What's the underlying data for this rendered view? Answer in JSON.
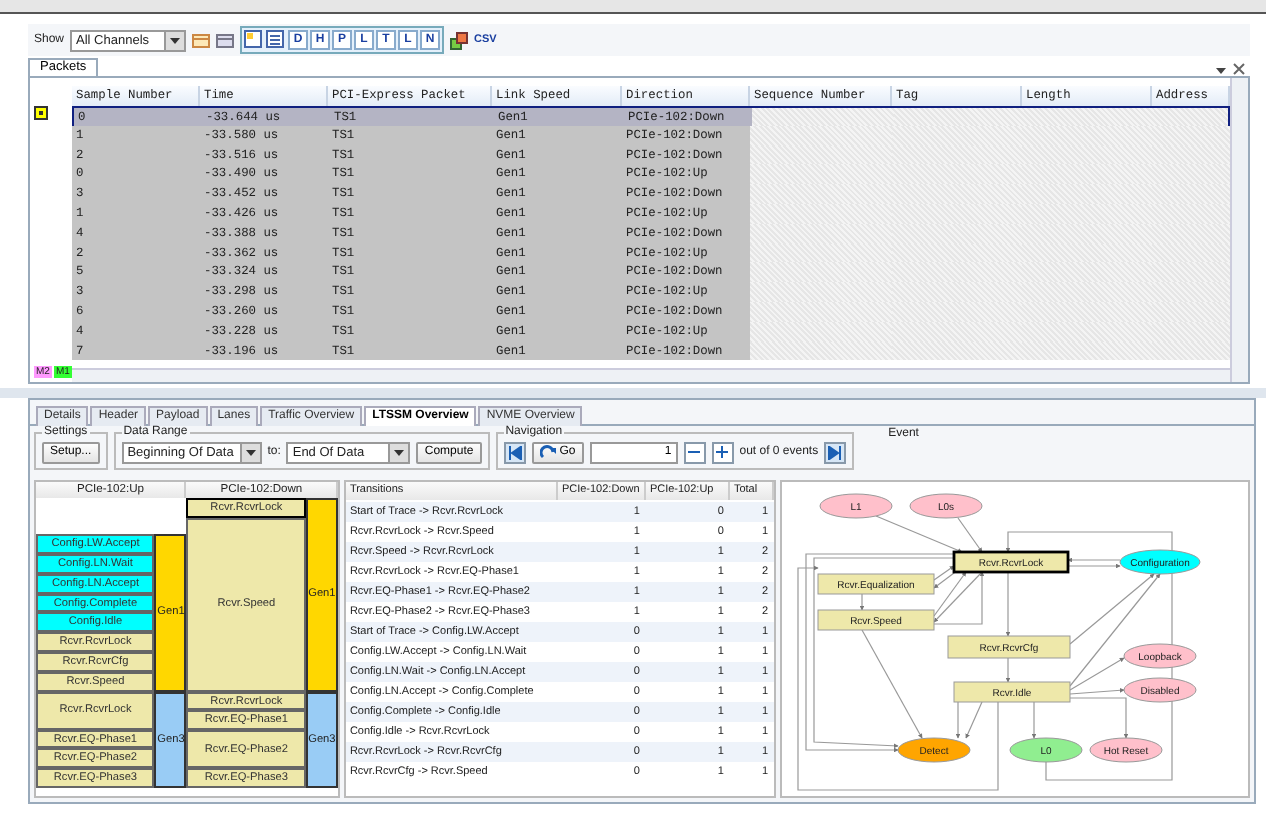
{
  "toolbar": {
    "show_label": "Show",
    "channel_select": "All Channels",
    "view_buttons": [
      {
        "label": "D"
      },
      {
        "label": "H"
      },
      {
        "label": "P"
      },
      {
        "label": "L"
      },
      {
        "label": "T"
      },
      {
        "label": "L"
      },
      {
        "label": "N"
      }
    ],
    "export_label": "CSV"
  },
  "document_tab": {
    "label": "Packets"
  },
  "packets": {
    "columns": [
      "Sample Number",
      "Time",
      "PCI-Express Packet",
      "Link Speed",
      "Direction",
      "Sequence Number",
      "Tag",
      "Length",
      "Address"
    ],
    "rows": [
      {
        "sample": "0",
        "time": "-33.644 us",
        "packet": "TS1",
        "speed": "Gen1",
        "direction": "PCIe-102:Down",
        "selected": true
      },
      {
        "sample": "1",
        "time": "-33.580 us",
        "packet": "TS1",
        "speed": "Gen1",
        "direction": "PCIe-102:Down",
        "selected": false
      },
      {
        "sample": "2",
        "time": "-33.516 us",
        "packet": "TS1",
        "speed": "Gen1",
        "direction": "PCIe-102:Down",
        "selected": false
      },
      {
        "sample": "0",
        "time": "-33.490 us",
        "packet": "TS1",
        "speed": "Gen1",
        "direction": "PCIe-102:Up",
        "selected": false
      },
      {
        "sample": "3",
        "time": "-33.452 us",
        "packet": "TS1",
        "speed": "Gen1",
        "direction": "PCIe-102:Down",
        "selected": false
      },
      {
        "sample": "1",
        "time": "-33.426 us",
        "packet": "TS1",
        "speed": "Gen1",
        "direction": "PCIe-102:Up",
        "selected": false
      },
      {
        "sample": "4",
        "time": "-33.388 us",
        "packet": "TS1",
        "speed": "Gen1",
        "direction": "PCIe-102:Down",
        "selected": false
      },
      {
        "sample": "2",
        "time": "-33.362 us",
        "packet": "TS1",
        "speed": "Gen1",
        "direction": "PCIe-102:Up",
        "selected": false
      },
      {
        "sample": "5",
        "time": "-33.324 us",
        "packet": "TS1",
        "speed": "Gen1",
        "direction": "PCIe-102:Down",
        "selected": false
      },
      {
        "sample": "3",
        "time": "-33.298 us",
        "packet": "TS1",
        "speed": "Gen1",
        "direction": "PCIe-102:Up",
        "selected": false
      },
      {
        "sample": "6",
        "time": "-33.260 us",
        "packet": "TS1",
        "speed": "Gen1",
        "direction": "PCIe-102:Down",
        "selected": false
      },
      {
        "sample": "4",
        "time": "-33.228 us",
        "packet": "TS1",
        "speed": "Gen1",
        "direction": "PCIe-102:Up",
        "selected": false
      },
      {
        "sample": "7",
        "time": "-33.196 us",
        "packet": "TS1",
        "speed": "Gen1",
        "direction": "PCIe-102:Down",
        "selected": false
      }
    ]
  },
  "markers": [
    {
      "label": "M2",
      "color": "#ff99ff"
    },
    {
      "label": "M1",
      "color": "#33ff33"
    }
  ],
  "bottom_tabs": [
    {
      "label": "Details",
      "selected": false
    },
    {
      "label": "Header",
      "selected": false
    },
    {
      "label": "Payload",
      "selected": false
    },
    {
      "label": "Lanes",
      "selected": false
    },
    {
      "label": "Traffic Overview",
      "selected": false
    },
    {
      "label": "LTSSM Overview",
      "selected": true
    },
    {
      "label": "NVME Overview",
      "selected": false
    }
  ],
  "settings": {
    "title": "Settings",
    "button": "Setup..."
  },
  "data_range": {
    "title": "Data Range",
    "from": "Beginning Of Data",
    "to_label": "to:",
    "to": "End Of Data",
    "button": "Compute"
  },
  "navigation": {
    "title": "Navigation",
    "go": "Go",
    "event_number": "1",
    "count_text": "out of 0 events"
  },
  "event": {
    "title": "Event"
  },
  "ltssm": {
    "lanes": [
      {
        "name": "PCIe-102:Up",
        "gens": [
          {
            "label": "Gen1",
            "color": "#ffd700",
            "states": [
              {
                "label": "Config.LW.Accept",
                "kind": "short",
                "color": "#00ffff",
                "selected": false
              },
              {
                "label": "Config.LN.Wait",
                "kind": "short",
                "color": "#00ffff",
                "selected": false
              },
              {
                "label": "Config.LN.Accept",
                "kind": "short",
                "color": "#00ffff",
                "selected": false
              },
              {
                "label": "Config.Complete",
                "kind": "short",
                "color": "#00ffff",
                "selected": false
              },
              {
                "label": "Config.Idle",
                "kind": "short",
                "color": "#00ffff",
                "selected": false
              },
              {
                "label": "Rcvr.RcvrLock",
                "kind": "short",
                "color": "#eee8aa",
                "selected": false
              },
              {
                "label": "Rcvr.RcvrCfg",
                "kind": "short",
                "color": "#eee8aa",
                "selected": false
              },
              {
                "label": "Rcvr.Speed",
                "kind": "short",
                "color": "#eee8aa",
                "selected": false
              }
            ]
          },
          {
            "label": "Gen3",
            "color": "#99ccf5",
            "states": [
              {
                "label": "Rcvr.RcvrLock",
                "kind": "long",
                "color": "#eee8aa",
                "selected": false
              },
              {
                "label": "Rcvr.EQ-Phase1",
                "kind": "short",
                "color": "#eee8aa",
                "selected": false
              },
              {
                "label": "Rcvr.EQ-Phase2",
                "kind": "short",
                "color": "#eee8aa",
                "selected": false
              },
              {
                "label": "Rcvr.EQ-Phase3",
                "kind": "short",
                "color": "#eee8aa",
                "selected": false
              }
            ]
          }
        ]
      },
      {
        "name": "PCIe-102:Down",
        "gens": [
          {
            "label": "Gen1",
            "color": "#ffd700",
            "states": [
              {
                "label": "Rcvr.RcvrLock",
                "kind": "short",
                "color": "#eee8aa",
                "selected": true
              },
              {
                "label": "Rcvr.Speed",
                "kind": "fill",
                "color": "#eee8aa",
                "selected": false
              }
            ]
          },
          {
            "label": "Gen3",
            "color": "#99ccf5",
            "states": [
              {
                "label": "Rcvr.RcvrLock",
                "kind": "short",
                "color": "#eee8aa",
                "selected": false
              },
              {
                "label": "Rcvr.EQ-Phase1",
                "kind": "short",
                "color": "#eee8aa",
                "selected": false
              },
              {
                "label": "Rcvr.EQ-Phase2",
                "kind": "long",
                "color": "#eee8aa",
                "selected": false
              },
              {
                "label": "Rcvr.EQ-Phase3",
                "kind": "short",
                "color": "#eee8aa",
                "selected": false
              }
            ]
          }
        ]
      }
    ]
  },
  "transitions": {
    "columns": [
      "Transitions",
      "PCIe-102:Down",
      "PCIe-102:Up",
      "Total"
    ],
    "rows": [
      [
        "Start of Trace -> Rcvr.RcvrLock",
        "1",
        "0",
        "1"
      ],
      [
        "Rcvr.RcvrLock -> Rcvr.Speed",
        "1",
        "0",
        "1"
      ],
      [
        "Rcvr.Speed -> Rcvr.RcvrLock",
        "1",
        "1",
        "2"
      ],
      [
        "Rcvr.RcvrLock -> Rcvr.EQ-Phase1",
        "1",
        "1",
        "2"
      ],
      [
        "Rcvr.EQ-Phase1 -> Rcvr.EQ-Phase2",
        "1",
        "1",
        "2"
      ],
      [
        "Rcvr.EQ-Phase2 -> Rcvr.EQ-Phase3",
        "1",
        "1",
        "2"
      ],
      [
        "Start of Trace -> Config.LW.Accept",
        "0",
        "1",
        "1"
      ],
      [
        "Config.LW.Accept -> Config.LN.Wait",
        "0",
        "1",
        "1"
      ],
      [
        "Config.LN.Wait -> Config.LN.Accept",
        "0",
        "1",
        "1"
      ],
      [
        "Config.LN.Accept -> Config.Complete",
        "0",
        "1",
        "1"
      ],
      [
        "Config.Complete -> Config.Idle",
        "0",
        "1",
        "1"
      ],
      [
        "Config.Idle -> Rcvr.RcvrLock",
        "0",
        "1",
        "1"
      ],
      [
        "Rcvr.RcvrLock -> Rcvr.RcvrCfg",
        "0",
        "1",
        "1"
      ],
      [
        "Rcvr.RcvrCfg -> Rcvr.Speed",
        "0",
        "1",
        "1"
      ]
    ]
  },
  "diagram": {
    "nodes": [
      {
        "label": "L1",
        "kind": "ellipse",
        "color": "#ffc0cb",
        "selected": false
      },
      {
        "label": "L0s",
        "kind": "ellipse",
        "color": "#ffc0cb",
        "selected": false
      },
      {
        "label": "Rcvr.RcvrLock",
        "kind": "rect",
        "color": "#eee8aa",
        "selected": true
      },
      {
        "label": "Configuration",
        "kind": "ellipse",
        "color": "#00ffff",
        "selected": false
      },
      {
        "label": "Rcvr.Equalization",
        "kind": "rect",
        "color": "#eee8aa",
        "selected": false
      },
      {
        "label": "Rcvr.Speed",
        "kind": "rect",
        "color": "#eee8aa",
        "selected": false
      },
      {
        "label": "Rcvr.RcvrCfg",
        "kind": "rect",
        "color": "#eee8aa",
        "selected": false
      },
      {
        "label": "Loopback",
        "kind": "ellipse",
        "color": "#ffc0cb",
        "selected": false
      },
      {
        "label": "Disabled",
        "kind": "ellipse",
        "color": "#ffc0cb",
        "selected": false
      },
      {
        "label": "Rcvr.Idle",
        "kind": "rect",
        "color": "#eee8aa",
        "selected": false
      },
      {
        "label": "Detect",
        "kind": "ellipse",
        "color": "#ffa500",
        "selected": false
      },
      {
        "label": "L0",
        "kind": "ellipse",
        "color": "#90ee90",
        "selected": false
      },
      {
        "label": "Hot Reset",
        "kind": "ellipse",
        "color": "#ffc0cb",
        "selected": false
      }
    ]
  }
}
